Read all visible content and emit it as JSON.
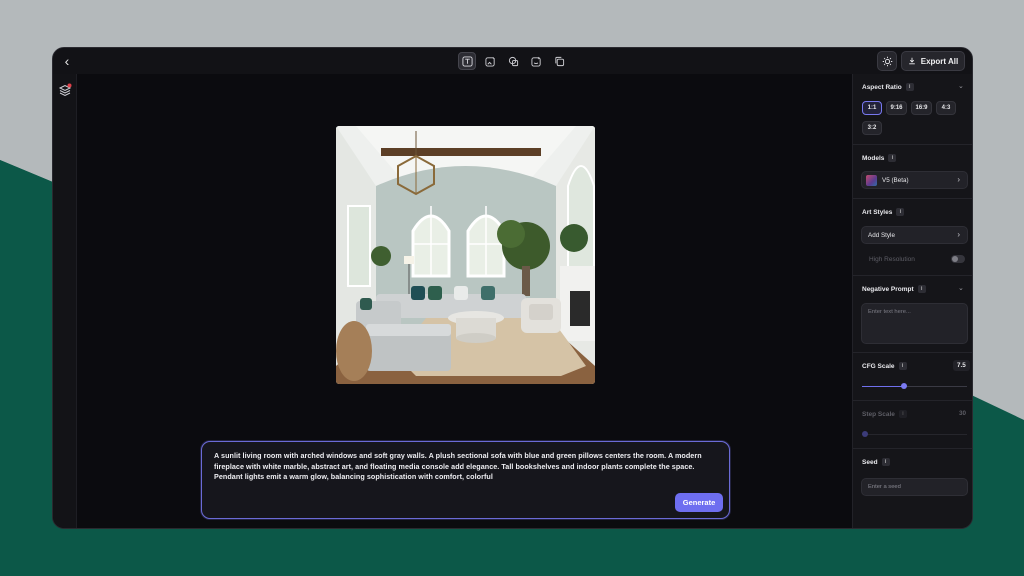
{
  "theme": {
    "accent": "#6e6ef0",
    "background_outer": "#b4b9bb",
    "teal": "#0c5848",
    "window_bg": "#0d0d11"
  },
  "topbar": {
    "back_icon": "chevron-left-icon",
    "tools": [
      {
        "name": "text-tool-icon",
        "active": true
      },
      {
        "name": "image-edit-icon",
        "active": false
      },
      {
        "name": "shapes-icon",
        "active": false
      },
      {
        "name": "sticker-icon",
        "active": false
      },
      {
        "name": "copy-icon",
        "active": false
      }
    ],
    "export_label": "Export All"
  },
  "prompt": {
    "text": "A sunlit living room with arched windows and soft gray walls. A plush sectional sofa with blue and green pillows centers the room. A modern fireplace with white marble, abstract art, and floating media console add elegance. Tall bookshelves and indoor plants complete the space. Pendant lights emit a warm glow, balancing sophistication with comfort, colorful",
    "generate_label": "Generate"
  },
  "sidebar": {
    "aspect_ratio": {
      "title": "Aspect Ratio",
      "info": "i",
      "options": [
        "1:1",
        "9:16",
        "16:9",
        "4:3",
        "3:2"
      ],
      "selected": "1:1"
    },
    "models": {
      "title": "Models",
      "info": "i",
      "selected": "V5 (Beta)"
    },
    "art_styles": {
      "title": "Art Styles",
      "info": "i",
      "add_label": "Add Style",
      "high_resolution_label": "High Resolution",
      "high_resolution_on": false
    },
    "negative_prompt": {
      "title": "Negative Prompt",
      "info": "i",
      "placeholder": "Enter text here..."
    },
    "cfg_scale": {
      "title": "CFG Scale",
      "info": "i",
      "value": "7.5",
      "fraction": 0.4
    },
    "step_scale": {
      "title": "Step Scale",
      "info": "i",
      "value": "30",
      "fraction": 0.0
    },
    "seed": {
      "title": "Seed",
      "info": "i",
      "placeholder": "Enter a seed"
    }
  }
}
